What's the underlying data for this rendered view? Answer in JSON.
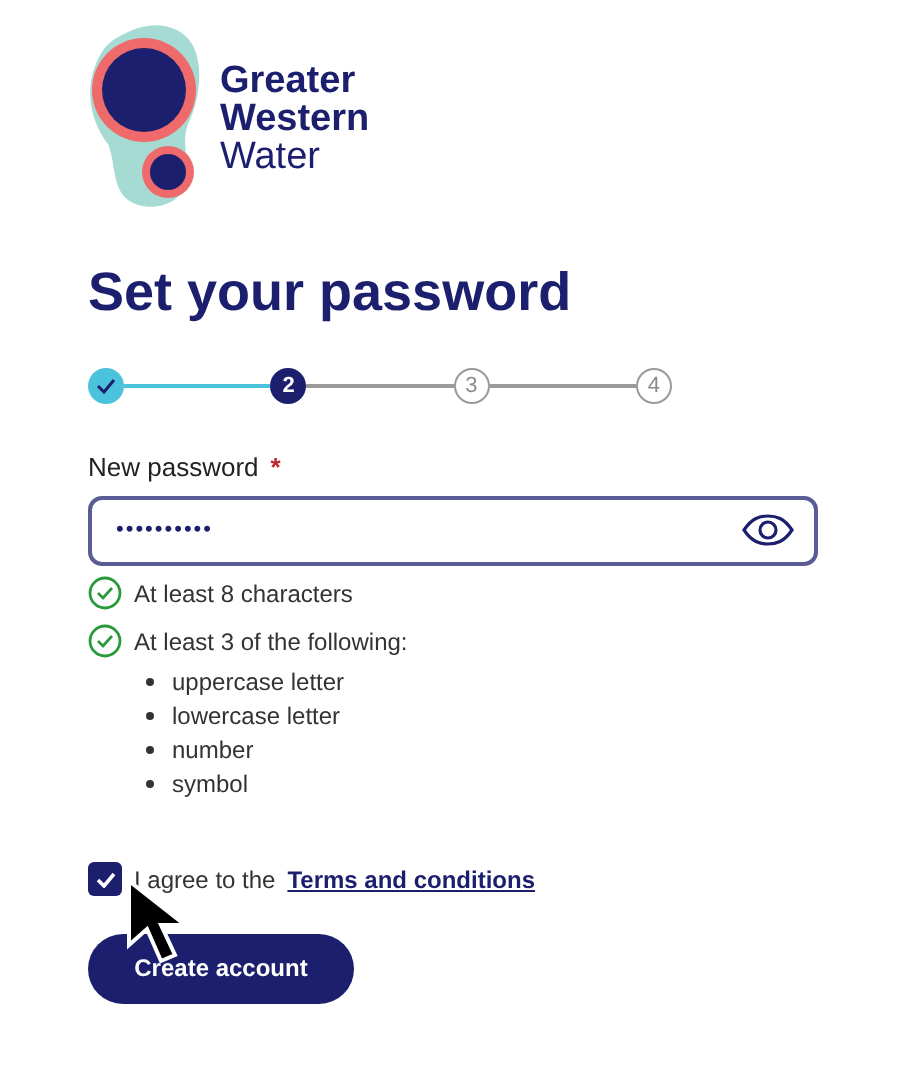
{
  "brand": {
    "line_1": "Greater",
    "line_2": "Western",
    "line_3": "Water"
  },
  "title": "Set your password",
  "steps": [
    {
      "completed": true,
      "selected": false
    },
    {
      "label": "2",
      "completed": false,
      "selected": true
    },
    {
      "label": "3",
      "completed": false,
      "selected": false
    },
    {
      "label": "4",
      "completed": false,
      "selected": false
    }
  ],
  "password_field": {
    "label": "New password",
    "required_mark": "*",
    "value": "••••••••••"
  },
  "requirements": [
    {
      "text": "At least 8 characters",
      "met": true
    },
    {
      "text": "At least 3 of the following:",
      "met": true
    }
  ],
  "requirement_options": [
    "uppercase letter",
    "lowercase letter",
    "number",
    "symbol"
  ],
  "terms": {
    "checked": true,
    "text": "I agree to the",
    "link": "Terms and conditions"
  },
  "submit_button": "Create account"
}
